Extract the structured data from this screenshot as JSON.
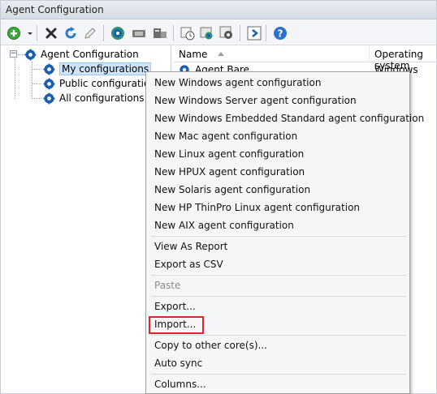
{
  "window": {
    "title": "Agent Configuration"
  },
  "toolbar": {
    "icons": [
      "add-icon",
      "dropdown-arrow-icon",
      "delete-icon",
      "refresh-icon",
      "edit-icon",
      "settings-gear-icon",
      "device-icon",
      "hardware-icon",
      "schedule-icon",
      "deploy-icon",
      "config-gear-icon",
      "run-icon",
      "help-icon"
    ],
    "accent": "#2a7ad1"
  },
  "tree": {
    "root": "Agent Configuration",
    "items": [
      {
        "label": "My configurations",
        "selected": true
      },
      {
        "label": "Public configurations",
        "selected": false
      },
      {
        "label": "All configurations",
        "selected": false
      }
    ]
  },
  "list": {
    "columns": [
      "Name",
      "Operating system"
    ],
    "rows": [
      {
        "name": "Agent Bare",
        "os": "Windows"
      }
    ]
  },
  "context_menu": {
    "items": [
      {
        "label": "New Windows agent configuration",
        "enabled": true
      },
      {
        "label": "New Windows Server agent configuration",
        "enabled": true
      },
      {
        "label": "New Windows Embedded Standard agent configuration",
        "enabled": true
      },
      {
        "label": "New Mac agent configuration",
        "enabled": true
      },
      {
        "label": "New Linux agent configuration",
        "enabled": true
      },
      {
        "label": "New HPUX agent configuration",
        "enabled": true
      },
      {
        "label": "New Solaris agent configuration",
        "enabled": true
      },
      {
        "label": "New HP ThinPro Linux agent configuration",
        "enabled": true
      },
      {
        "label": "New AIX agent configuration",
        "enabled": true
      },
      {
        "label": "View As Report",
        "enabled": true
      },
      {
        "label": "Export as CSV",
        "enabled": true
      },
      {
        "label": "Paste",
        "enabled": false
      },
      {
        "label": "Export...",
        "enabled": true
      },
      {
        "label": "Import...",
        "enabled": true,
        "highlighted": true
      },
      {
        "label": "Copy to other core(s)...",
        "enabled": true
      },
      {
        "label": "Auto sync",
        "enabled": true
      },
      {
        "label": "Columns...",
        "enabled": true
      }
    ],
    "highlight_color": "#e2222d"
  }
}
